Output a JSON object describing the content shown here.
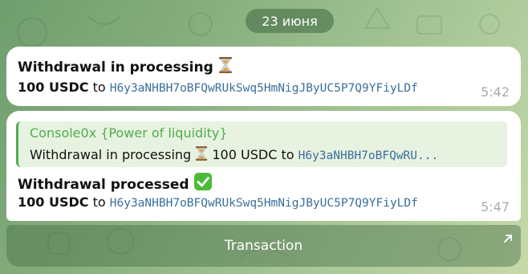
{
  "date": "23 июня",
  "messages": [
    {
      "title": "Withdrawal in processing",
      "title_icon": "hourglass-icon",
      "amount": "100 USDC",
      "to": "to",
      "address": "H6y3aNHBH7oBFQwRUkSwq5HmNigJByUC5P7Q9YFiyLDf",
      "time": "5:42"
    },
    {
      "reply": {
        "name": "Console0x {Power of liquidity}",
        "text_title": "Withdrawal in processing",
        "text_amount": "100 USDC to",
        "text_address": "H6y3aNHBH7oBFQwRU..."
      },
      "title": "Withdrawal processed",
      "title_icon": "check-mark-icon",
      "amount": "100 USDC",
      "to": "to",
      "address": "H6y3aNHBH7oBFQwRUkSwq5HmNigJByUC5P7Q9YFiyLDf",
      "time": "5:47"
    }
  ],
  "inline_button": {
    "label": "Transaction",
    "icon": "external-arrow-icon"
  },
  "colors": {
    "accent_green": "#4fae4e",
    "address_blue": "#3a6f9c",
    "check_green": "#4cbb3a"
  }
}
